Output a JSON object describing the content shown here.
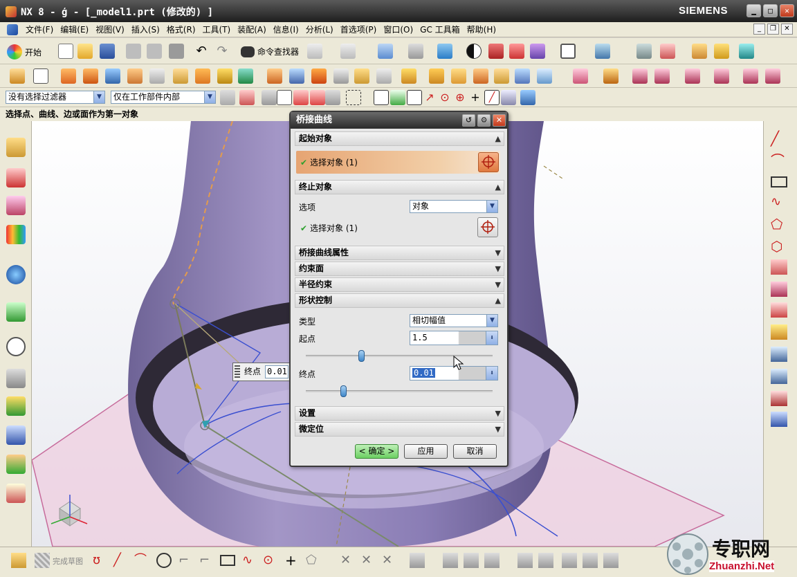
{
  "app": {
    "title": "NX 8 - ģ - [_model1.prt  (修改的) ]",
    "brand": "SIEMENS",
    "window_controls": [
      "minimize-icon",
      "maximize-icon",
      "close-icon"
    ]
  },
  "menu": {
    "items": [
      "文件(F)",
      "编辑(E)",
      "视图(V)",
      "插入(S)",
      "格式(R)",
      "工具(T)",
      "装配(A)",
      "信息(I)",
      "分析(L)",
      "首选项(P)",
      "窗口(O)",
      "GC 工具箱",
      "帮助(H)"
    ]
  },
  "toolbar1": {
    "start_label": "开始",
    "command_finder_label": "命令查找器"
  },
  "filterbar": {
    "type_filter": "没有选择过滤器",
    "scope_filter": "仅在工作部件内部"
  },
  "cue": "选择点、曲线、边或面作为第一对象",
  "dialog": {
    "title": "桥接曲线",
    "sections": {
      "start": {
        "header": "起始对象",
        "select_label": "选择对象 (1)"
      },
      "end": {
        "header": "终止对象",
        "option_label": "选项",
        "option_value": "对象",
        "select_label": "选择对象 (1)"
      },
      "props": {
        "header": "桥接曲线属性"
      },
      "constraint_face": {
        "header": "约束面"
      },
      "radius": {
        "header": "半径约束"
      },
      "shape": {
        "header": "形状控制",
        "type_label": "类型",
        "type_value": "相切幅值",
        "start_label": "起点",
        "start_value": "1.5",
        "end_label": "终点",
        "end_value": "0.01"
      },
      "settings": {
        "header": "设置"
      },
      "fine": {
        "header": "微定位"
      }
    },
    "buttons": {
      "ok": "< 确定 >",
      "apply": "应用",
      "cancel": "取消"
    }
  },
  "viewport_tip": {
    "label": "终点",
    "value": "0.01"
  },
  "bottombar": {
    "finish_sketch_label": "完成草图"
  },
  "watermark": {
    "cn": "专职网",
    "url": "Zhuanzhi.Net"
  }
}
